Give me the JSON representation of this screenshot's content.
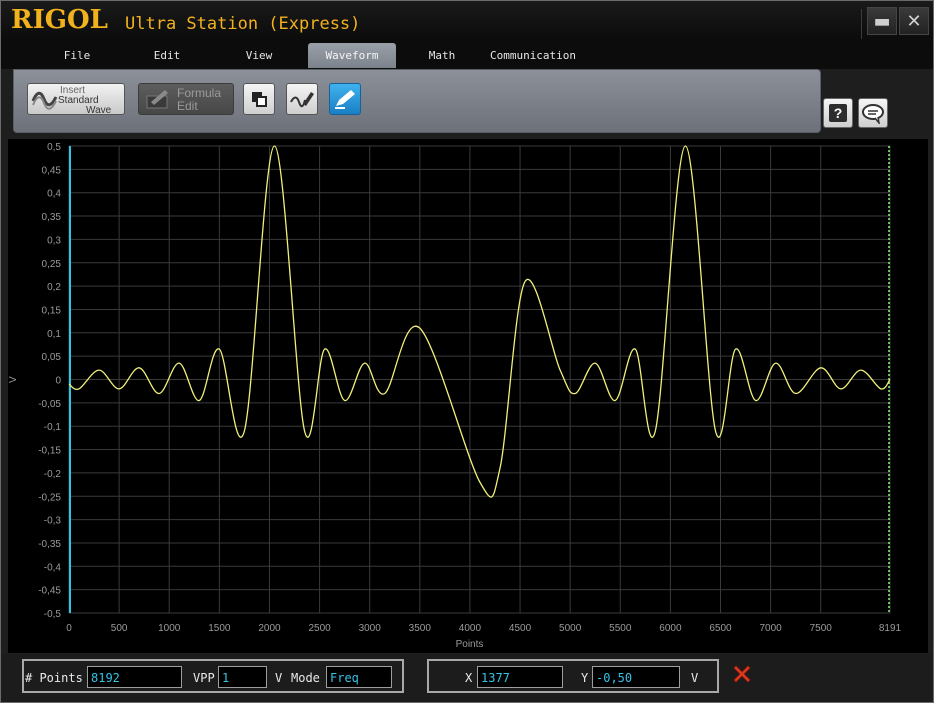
{
  "titlebar": {
    "brand": "RIGOL",
    "app_title": "Ultra Station (Express)",
    "minimize_glyph": "▬",
    "close_glyph": "✕"
  },
  "menu": [
    {
      "label": "File"
    },
    {
      "label": "Edit"
    },
    {
      "label": "View"
    },
    {
      "label": "Waveform",
      "active": true
    },
    {
      "label": "Math"
    },
    {
      "label": "Communication"
    }
  ],
  "toolbar": {
    "insert_line1": "Insert",
    "insert_line2": "Standard",
    "insert_line3": "Wave",
    "formula_line1": "Formula",
    "formula_line2": "Edit",
    "help_icon": "help-icon",
    "feedback_icon": "comment-icon"
  },
  "chart_data": {
    "type": "line",
    "xlabel": "Points",
    "ylabel": "V",
    "xlim": [
      0,
      8191
    ],
    "ylim": [
      -0.5,
      0.5
    ],
    "x_ticks": [
      "0",
      "500",
      "1000",
      "1500",
      "2000",
      "2500",
      "3000",
      "3500",
      "4000",
      "4500",
      "5000",
      "5500",
      "6000",
      "6500",
      "7000",
      "7500",
      "8191"
    ],
    "y_ticks": [
      "0,5",
      "0,45",
      "0,4",
      "0,35",
      "0,3",
      "0,25",
      "0,2",
      "0,15",
      "0,1",
      "0,05",
      "0",
      "-0,05",
      "-0,1",
      "-0,15",
      "-0,2",
      "-0,25",
      "-0,3",
      "-0,35",
      "-0,4",
      "-0,45",
      "-0,5"
    ],
    "grid": true,
    "colors": {
      "trace": "#f0f07a",
      "grid": "#3a3a3a",
      "left_marker": "#2ec4e6",
      "right_marker": "#7cfc6a"
    },
    "series": [
      {
        "x": [
          0,
          100,
          300,
          500,
          700,
          900,
          1100,
          1300,
          1500,
          1750,
          2050,
          2350,
          2550,
          2750,
          2950,
          3150,
          3500,
          4100,
          4300,
          4550,
          4900,
          5050,
          5250,
          5450,
          5650,
          5850,
          6150,
          6450,
          6650,
          6850,
          7050,
          7250,
          7500,
          7700,
          7900,
          8100,
          8191
        ],
        "y": [
          -0.01,
          -0.02,
          0.02,
          -0.02,
          0.025,
          -0.03,
          0.035,
          -0.045,
          0.065,
          -0.11,
          0.5,
          -0.11,
          0.065,
          -0.045,
          0.035,
          -0.03,
          0.11,
          -0.22,
          -0.19,
          0.21,
          0.02,
          -0.03,
          0.035,
          -0.045,
          0.065,
          -0.11,
          0.5,
          -0.11,
          0.065,
          -0.045,
          0.035,
          -0.03,
          0.025,
          -0.02,
          0.02,
          -0.02,
          0.0
        ]
      }
    ]
  },
  "status": {
    "points_label": "# Points",
    "points_value": "8192",
    "vpp_label": "VPP",
    "vpp_value": "1",
    "vpp_unit": "V",
    "mode_label": "Mode",
    "mode_value": "Freq",
    "x_label": "X",
    "x_value": "1377",
    "y_label": "Y",
    "y_value": "-0,50",
    "y_unit": "V"
  }
}
